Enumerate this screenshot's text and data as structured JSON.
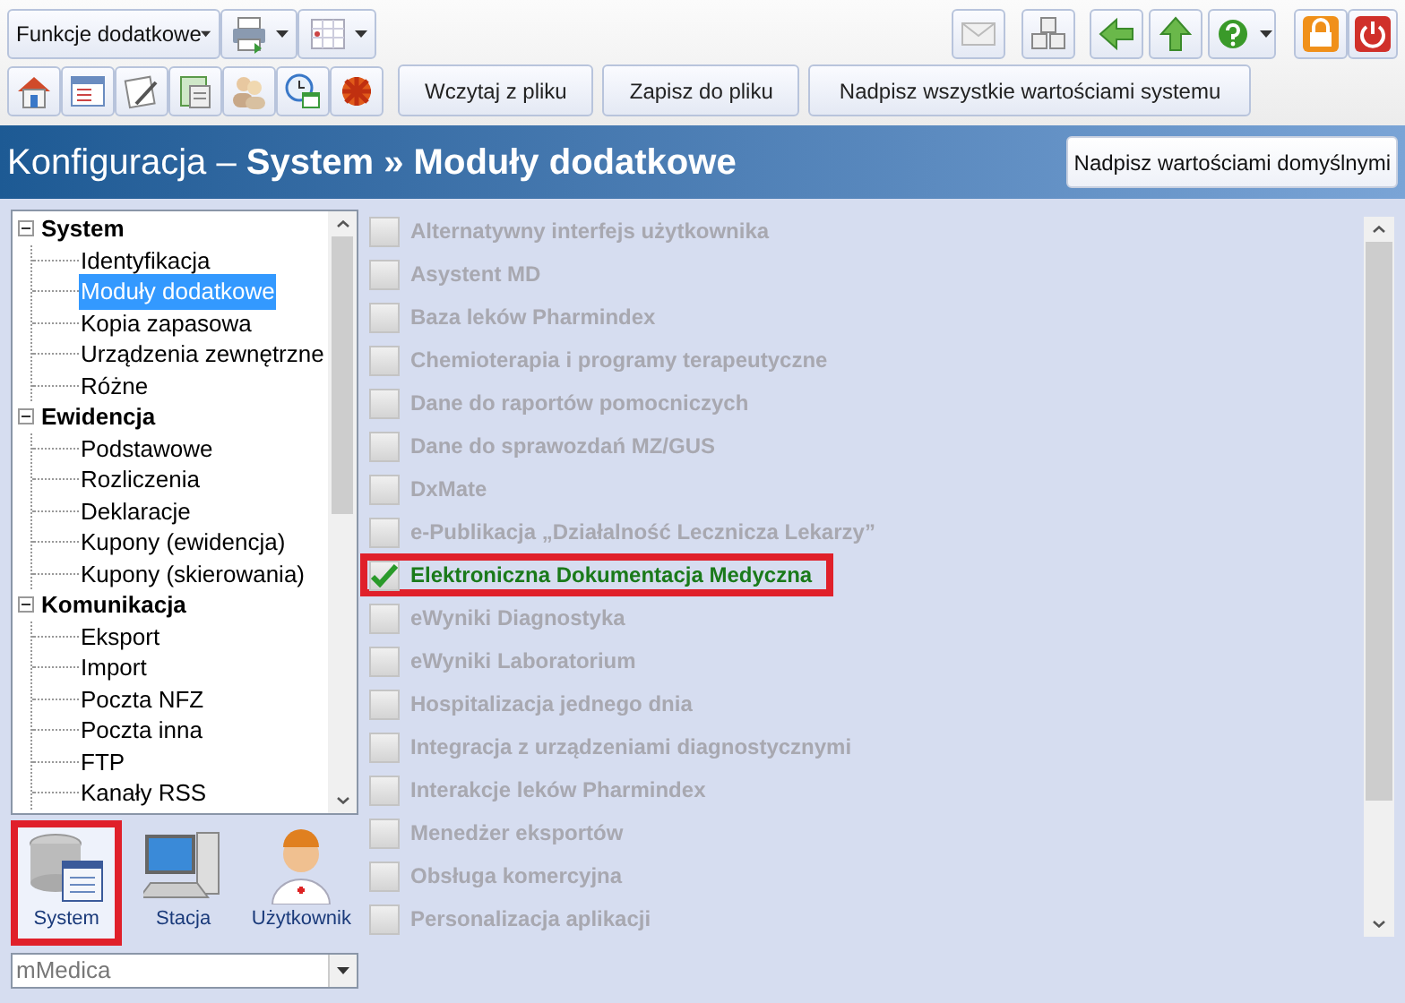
{
  "toolbar": {
    "menu_button": "Funkcje dodatkowe",
    "file_buttons": [
      "Wczytaj z pliku",
      "Zapisz do pliku",
      "Nadpisz wszystkie wartościami systemu"
    ]
  },
  "header": {
    "title": "Konfiguracja – **System » Moduły dodatkowe**",
    "button": "Nadpisz wartościami domyślnymi"
  },
  "tree": [
    {
      "label": "System",
      "expanded": true,
      "children": [
        {
          "label": "Identyfikacja",
          "selected": false
        },
        {
          "label": "Moduły dodatkowe",
          "selected": true
        },
        {
          "label": "Kopia zapasowa",
          "selected": false
        },
        {
          "label": "Urządzenia zewnętrzne",
          "selected": false
        },
        {
          "label": "Różne",
          "selected": false
        }
      ]
    },
    {
      "label": "Ewidencja",
      "expanded": true,
      "children": [
        {
          "label": "Podstawowe",
          "selected": false
        },
        {
          "label": "Rozliczenia",
          "selected": false
        },
        {
          "label": "Deklaracje",
          "selected": false
        },
        {
          "label": "Kupony (ewidencja)",
          "selected": false
        },
        {
          "label": "Kupony (skierowania)",
          "selected": false
        }
      ]
    },
    {
      "label": "Komunikacja",
      "expanded": true,
      "children": [
        {
          "label": "Eksport",
          "selected": false
        },
        {
          "label": "Import",
          "selected": false
        },
        {
          "label": "Poczta NFZ",
          "selected": false
        },
        {
          "label": "Poczta inna",
          "selected": false
        },
        {
          "label": "FTP",
          "selected": false
        },
        {
          "label": "Kanały RSS",
          "selected": false
        }
      ]
    }
  ],
  "scopes": [
    {
      "label": "System",
      "selected": true,
      "highlighted": true
    },
    {
      "label": "Stacja",
      "selected": false,
      "highlighted": false
    },
    {
      "label": "Użytkownik",
      "selected": false,
      "highlighted": false
    }
  ],
  "profile_select": {
    "value": "mMedica"
  },
  "modules": [
    {
      "label": "Alternatywny interfejs użytkownika",
      "checked": false,
      "highlighted": false
    },
    {
      "label": "Asystent MD",
      "checked": false,
      "highlighted": false
    },
    {
      "label": "Baza leków Pharmindex",
      "checked": false,
      "highlighted": false
    },
    {
      "label": "Chemioterapia i programy terapeutyczne",
      "checked": false,
      "highlighted": false
    },
    {
      "label": "Dane do raportów pomocniczych",
      "checked": false,
      "highlighted": false
    },
    {
      "label": "Dane do sprawozdań MZ/GUS",
      "checked": false,
      "highlighted": false
    },
    {
      "label": "DxMate",
      "checked": false,
      "highlighted": false
    },
    {
      "label": "e-Publikacja „Działalność Lecznicza Lekarzy”",
      "checked": false,
      "highlighted": false
    },
    {
      "label": "Elektroniczna Dokumentacja Medyczna",
      "checked": true,
      "highlighted": true
    },
    {
      "label": "eWyniki Diagnostyka",
      "checked": false,
      "highlighted": false
    },
    {
      "label": "eWyniki Laboratorium",
      "checked": false,
      "highlighted": false
    },
    {
      "label": "Hospitalizacja jednego dnia",
      "checked": false,
      "highlighted": false
    },
    {
      "label": "Integracja z urządzeniami diagnostycznymi",
      "checked": false,
      "highlighted": false
    },
    {
      "label": "Interakcje leków Pharmindex",
      "checked": false,
      "highlighted": false
    },
    {
      "label": "Menedżer eksportów",
      "checked": false,
      "highlighted": false
    },
    {
      "label": "Obsługa komercyjna",
      "checked": false,
      "highlighted": false
    },
    {
      "label": "Personalizacja aplikacji",
      "checked": false,
      "highlighted": false
    }
  ]
}
